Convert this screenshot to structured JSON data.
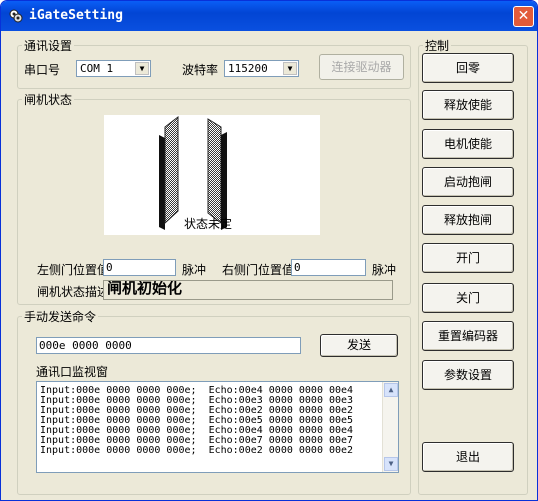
{
  "window": {
    "title": "iGateSetting",
    "close_glyph": "✕"
  },
  "comm": {
    "group_label": "通讯设置",
    "port_label": "串口号",
    "port_value": "COM 1",
    "baud_label": "波特率",
    "baud_value": "115200",
    "connect_button": "连接驱动器"
  },
  "gate": {
    "group_label": "闸机状态",
    "door_state_text": "状态未定",
    "left_pos_label": "左侧门位置值",
    "left_pos_value": "0",
    "left_unit": "脉冲",
    "right_pos_label": "右侧门位置值",
    "right_pos_value": "0",
    "right_unit": "脉冲",
    "desc_label": "闸机状态描述",
    "desc_value": "闸机初始化"
  },
  "manual": {
    "group_label": "手动发送命令",
    "command_value": "000e 0000 0000",
    "send_button": "发送",
    "monitor_label": "通讯口监视窗",
    "monitor_lines": [
      "Input:000e 0000 0000 000e;  Echo:00e4 0000 0000 00e4",
      "Input:000e 0000 0000 000e;  Echo:00e3 0000 0000 00e3",
      "Input:000e 0000 0000 000e;  Echo:00e2 0000 0000 00e2",
      "Input:000e 0000 0000 000e;  Echo:00e5 0000 0000 00e5",
      "Input:000e 0000 0000 000e;  Echo:00e4 0000 0000 00e4",
      "Input:000e 0000 0000 000e;  Echo:00e7 0000 0000 00e7",
      "Input:000e 0000 0000 000e;  Echo:00e2 0000 0000 00e2"
    ]
  },
  "control": {
    "group_label": "控制",
    "buttons": [
      "回零",
      "释放使能",
      "电机使能",
      "启动抱闸",
      "释放抱闸",
      "开门",
      "关门",
      "重置编码器",
      "参数设置"
    ],
    "exit_button": "退出"
  },
  "colors": {
    "titlebar": "#0245d4",
    "face": "#ece9d8",
    "field_border": "#7f9db9"
  }
}
